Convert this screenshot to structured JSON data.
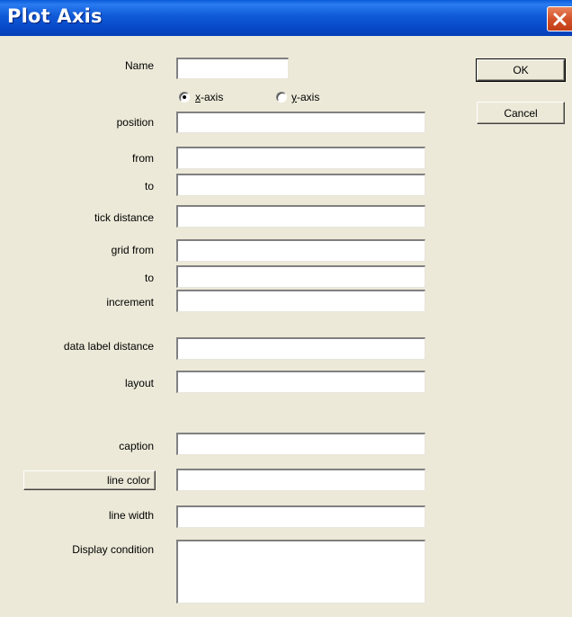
{
  "window": {
    "title": "Plot Axis"
  },
  "form": {
    "name_label": "Name",
    "axis_options": [
      {
        "label_first": "x",
        "label_rest": "-axis",
        "checked": true
      },
      {
        "label_first": "y",
        "label_rest": "-axis",
        "checked": false
      }
    ],
    "position_label": "position",
    "from_label": "from",
    "to_label": "to",
    "tick_distance_label": "tick distance",
    "grid_from_label": "grid from",
    "grid_to_label": "to",
    "increment_label": "increment",
    "data_label_distance_label": "data label distance",
    "layout_label": "layout",
    "caption_label": "caption",
    "line_color_button": "line color",
    "line_width_label": "line width",
    "display_condition_label": "Display condition"
  },
  "values": {
    "name": "",
    "position": "",
    "from": "",
    "to": "",
    "tick_distance": "",
    "grid_from": "",
    "grid_to": "",
    "increment": "",
    "data_label_distance": "",
    "layout": "",
    "caption": "",
    "line_color": "",
    "line_width": "",
    "display_condition": ""
  },
  "buttons": {
    "ok": "OK",
    "cancel": "Cancel"
  },
  "icons": {
    "close": "close-icon",
    "radio": "radio-button"
  }
}
